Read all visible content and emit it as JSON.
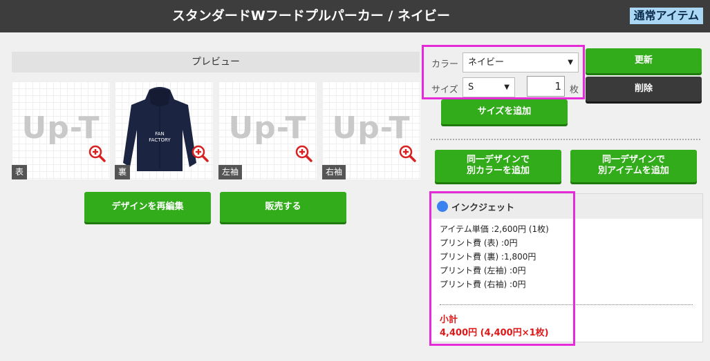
{
  "header": {
    "title": "スタンダードWフードプルパーカー / ネイビー",
    "badge": "通常アイテム"
  },
  "preview": {
    "heading": "プレビュー",
    "thumbnails": [
      {
        "side": "表",
        "logo": "Up-T"
      },
      {
        "side": "裏",
        "shirt_text_1": "FAN",
        "shirt_text_2": "FACTORY"
      },
      {
        "side": "左袖",
        "logo": "Up-T"
      },
      {
        "side": "右袖",
        "logo": "Up-T"
      }
    ],
    "buttons": {
      "reedit": "デザインを再編集",
      "sell": "販売する"
    }
  },
  "options": {
    "color_label": "カラー",
    "color_value": "ネイビー",
    "size_label": "サイズ",
    "size_value": "S",
    "quantity": "1",
    "quantity_unit": "枚",
    "add_size": "サイズを追加",
    "update": "更新",
    "delete": "削除",
    "same_design_other_color": [
      "同一デザインで",
      "別カラーを追加"
    ],
    "same_design_other_item": [
      "同一デザインで",
      "別アイテムを追加"
    ]
  },
  "pricing": {
    "method": "インクジェット",
    "lines": [
      "アイテム単価 :2,600円 (1枚)",
      "プリント費 (表) :0円",
      "プリント費 (裏) :1,800円",
      "プリント費 (左袖) :0円",
      "プリント費 (右袖) :0円"
    ],
    "subtotal_label": "小計",
    "subtotal_value": "4,400円 (4,400円×1枚)"
  },
  "colors": {
    "green": "#32ac1a",
    "dark": "#3a3a3a",
    "highlight": "#e52bd8",
    "header": "#3d3d3d",
    "badge": "#a9d7f4",
    "subtotal": "#e01818",
    "ink_dot": "#3b82f0",
    "hoodie": "#1b2440"
  },
  "icons": {
    "zoom": "zoom-in-icon",
    "caret": "caret-down-icon",
    "ink": "ink-dot-icon"
  }
}
